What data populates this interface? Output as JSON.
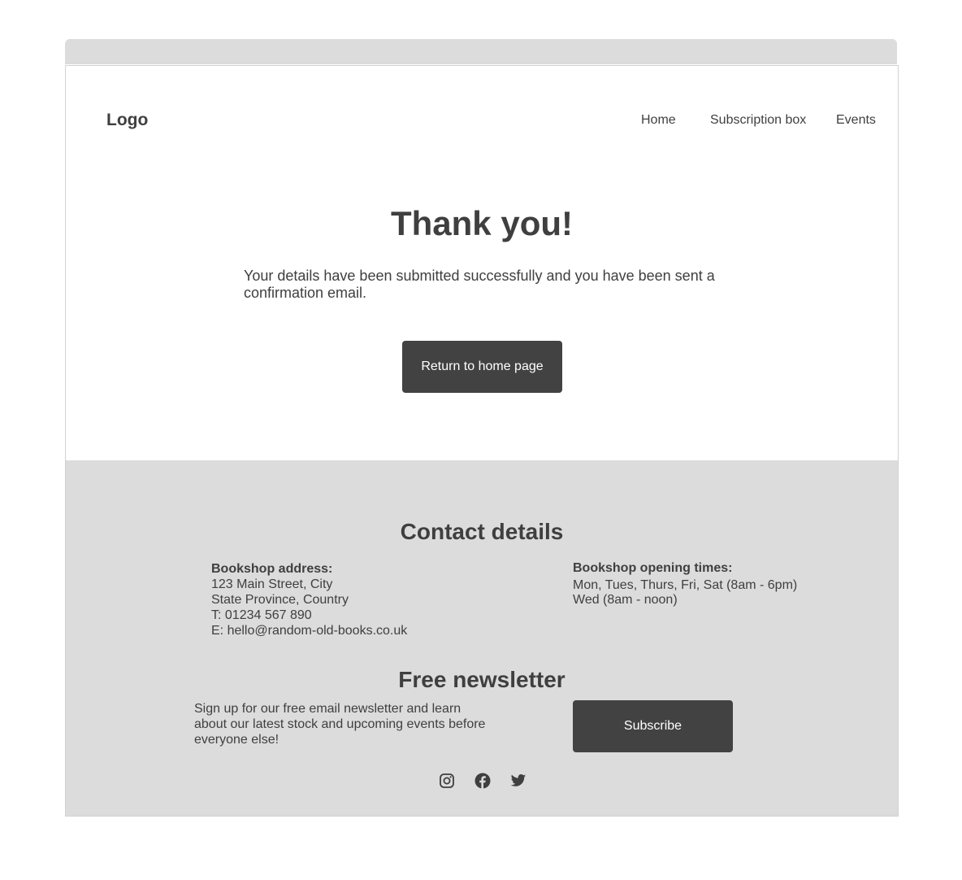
{
  "header": {
    "logo": "Logo",
    "nav": [
      "Home",
      "Subscription box",
      "Events"
    ]
  },
  "hero": {
    "title": "Thank you!",
    "message": "Your details have been submitted successfully and you have been sent a confirmation email.",
    "button": "Return to home page"
  },
  "contact": {
    "title": "Contact details",
    "address_heading": "Bookshop address:",
    "address_lines": [
      "123 Main Street, City",
      "State Province, Country",
      "T: 01234 567 890",
      "E: hello@random-old-books.co.uk"
    ],
    "hours_heading": "Bookshop opening times:",
    "hours_lines": [
      "Mon, Tues, Thurs, Fri, Sat (8am - 6pm)",
      "Wed (8am - noon)"
    ]
  },
  "newsletter": {
    "title": "Free newsletter",
    "text": "Sign up for our free email newsletter and learn about our latest stock and upcoming events before everyone else!",
    "button": "Subscribe"
  },
  "social": [
    "instagram-icon",
    "facebook-icon",
    "twitter-icon"
  ],
  "colors": {
    "text": "#3f3f3f",
    "button": "#424242",
    "footer_bg": "#dcdcdc"
  }
}
